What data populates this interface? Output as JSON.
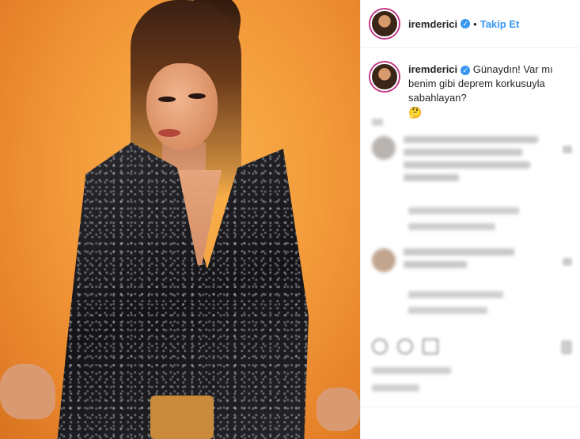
{
  "header": {
    "username": "iremderici",
    "separator": "•",
    "follow_label": "Takip Et"
  },
  "caption": {
    "username": "iremderici",
    "text": "Günaydın! Var mı benim gibi deprem korkusuyla sabahlayan?",
    "emoji": "🤔"
  },
  "icons": {
    "verified": "verified-badge-icon",
    "like": "heart-icon",
    "comment": "comment-icon",
    "share": "share-icon",
    "save": "bookmark-icon"
  },
  "colors": {
    "link_blue": "#3897f0",
    "text": "#262626",
    "story_ring": "#c13584"
  }
}
